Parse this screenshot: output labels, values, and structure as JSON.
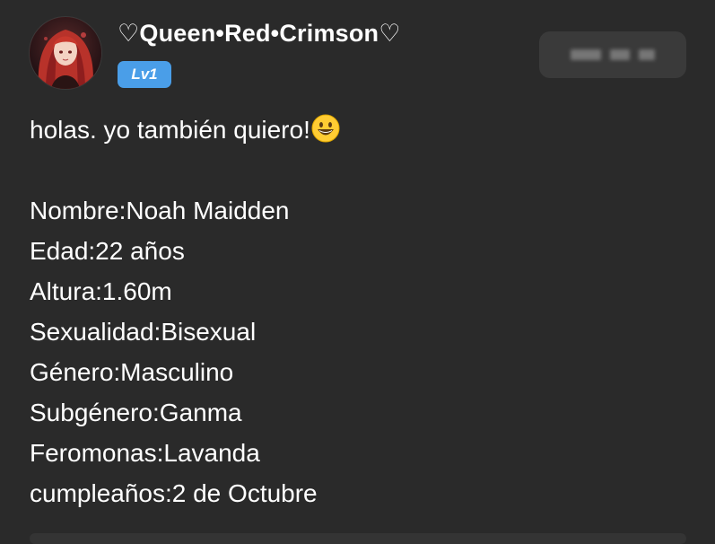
{
  "post": {
    "author": {
      "name": "♡Queen•Red•Crimson♡",
      "level": "Lv1",
      "avatar_icon": "avatar-red-hair"
    },
    "intro": "holas. yo también quiero!",
    "intro_emoji": "grinning-face-emoji",
    "fields": [
      "Nombre:Noah Maidden",
      "Edad:22 años",
      "Altura:1.60m",
      "Sexualidad:Bisexual",
      "Género:Masculino",
      "Subgénero:Ganma",
      "Feromonas:Lavanda",
      "cumpleaños:2 de Octubre"
    ]
  },
  "colors": {
    "background": "#2a2a2a",
    "text": "#ffffff",
    "level_badge": "#4a9ee8",
    "time_pill": "#3a3a3a"
  }
}
